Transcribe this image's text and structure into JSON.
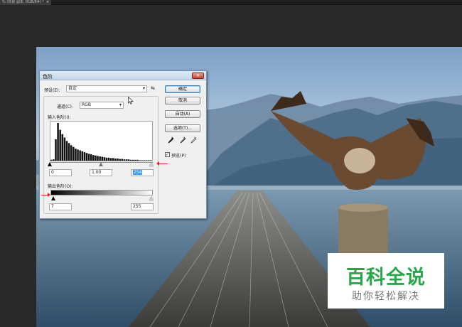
{
  "document_tab": {
    "label": "% (背景 副本, RGB/8#) *",
    "close": "×"
  },
  "levels_dialog": {
    "title": "色阶",
    "close_symbol": "✕",
    "preset_label": "预设(E):",
    "preset_value": "自定",
    "channel_label": "通道(C):",
    "channel_value": "RGB",
    "input_levels_label": "输入色阶(I):",
    "input_black": "0",
    "input_gamma": "1.00",
    "input_white": "254",
    "output_levels_label": "输出色阶(O):",
    "output_black": "7",
    "output_white": "255",
    "buttons": {
      "ok": "确定",
      "cancel": "取消",
      "auto": "自动(A)",
      "options": "选项(T)..."
    },
    "preview_label": "预览(P)",
    "preview_checked": true,
    "preset_menu_icon": "preset-options-icon",
    "eyedropper_icons": [
      "black-eyedropper-icon",
      "gray-eyedropper-icon",
      "white-eyedropper-icon"
    ],
    "histogram": [
      2,
      3,
      50,
      88,
      72,
      62,
      54,
      46,
      41,
      36,
      32,
      28,
      26,
      24,
      22,
      20,
      18,
      16,
      15,
      13,
      12,
      11,
      10,
      9,
      8,
      7,
      7,
      6,
      6,
      5,
      5,
      4,
      4,
      3,
      3,
      3,
      2,
      2,
      2,
      2,
      1,
      1,
      1,
      1,
      1,
      1
    ]
  },
  "watermark": {
    "title": "百科全说",
    "subtitle": "助你轻松解决"
  },
  "colors": {
    "annotation_arrow": "#e0231c",
    "watermark_green": "#2aa64a",
    "dialog_border": "#6d8fb3"
  }
}
